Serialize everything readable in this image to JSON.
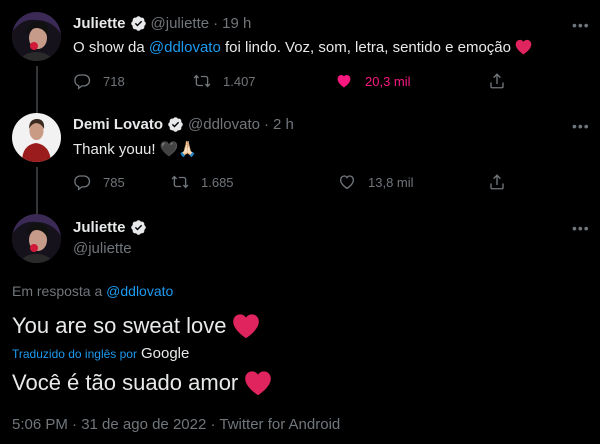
{
  "tweet1": {
    "name": "Juliette",
    "handle": "@juliette",
    "separator": "·",
    "time": "19 h",
    "text_before": "O show da ",
    "mention": "@ddlovato",
    "text_after": " foi lindo. Voz, som, letra, sentido e emoção",
    "replies": "718",
    "retweets": "1.407",
    "likes": "20,3 mil",
    "more": "•••"
  },
  "tweet2": {
    "name": "Demi Lovato",
    "handle": "@ddlovato",
    "separator": "·",
    "time": "2 h",
    "text": "Thank youu! 🖤🙏🏻",
    "replies": "785",
    "retweets": "1.685",
    "likes": "13,8 mil",
    "more": "•••"
  },
  "main_tweet": {
    "name": "Juliette",
    "handle": "@juliette",
    "reply_label": "Em resposta a ",
    "reply_mention": "@ddlovato",
    "text": "You are so sweat love",
    "translated_label": "Traduzido do inglês por",
    "translator": "Google",
    "translation": "Você é tão suado amor",
    "footer": "5:06 PM · 31 de ago de 2022 · Twitter for Android",
    "more": "•••"
  },
  "colors": {
    "background": "#000000",
    "text": "#e7e9ea",
    "muted": "#71767b",
    "accent": "#1d9bf0",
    "like": "#f91880",
    "heart_emoji": "#e0245e"
  },
  "icons": [
    "verified-badge-icon",
    "reply-icon",
    "retweet-icon",
    "like-icon",
    "share-icon",
    "more-icon",
    "heart-emoji-icon"
  ]
}
